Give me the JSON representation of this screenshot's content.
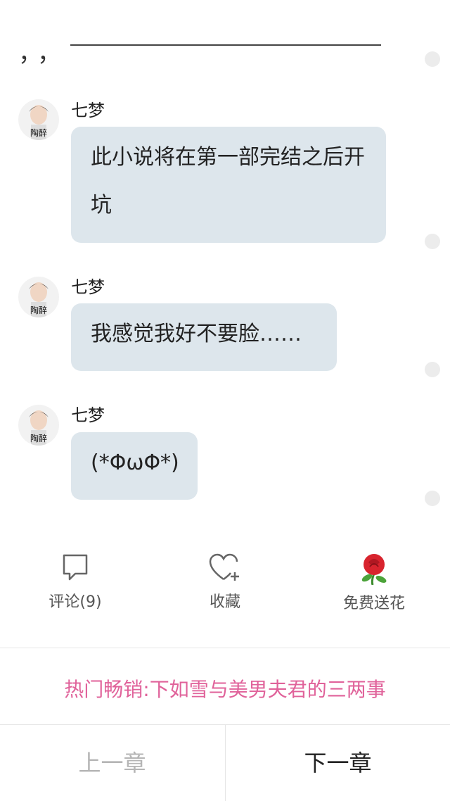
{
  "header": {
    "quote_marks": "，，"
  },
  "messages": [
    {
      "sender": "七梦",
      "avatar_text": "陶醉",
      "text": "此小说将在第一部完结之后开坑"
    },
    {
      "sender": "七梦",
      "avatar_text": "陶醉",
      "text": "我感觉我好不要脸……"
    },
    {
      "sender": "七梦",
      "avatar_text": "陶醉",
      "text": "(*ΦωΦ*)"
    }
  ],
  "actions": {
    "comment": {
      "label": "评论(9)",
      "icon": "comment-bubble-icon"
    },
    "favorite": {
      "label": "收藏",
      "icon": "heart-plus-icon"
    },
    "flower": {
      "label": "免费送花",
      "icon": "rose-icon"
    }
  },
  "promo": {
    "text": "热门畅销:下如雪与美男夫君的三两事"
  },
  "nav": {
    "prev_label": "上一章",
    "next_label": "下一章"
  },
  "colors": {
    "bubble": "#dde6ec",
    "promo": "#e0629a",
    "rose": "#d8242e"
  }
}
